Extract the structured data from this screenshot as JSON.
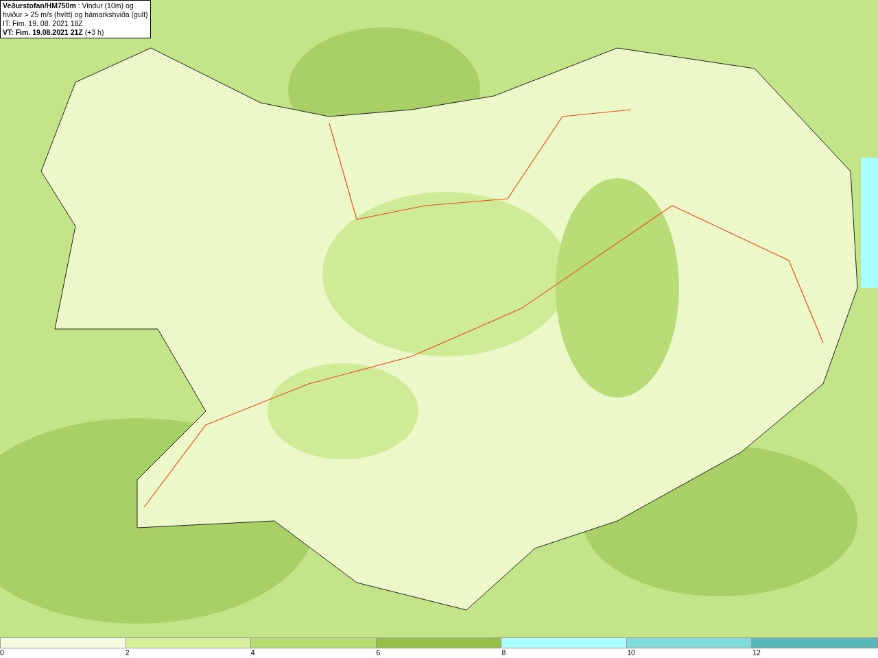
{
  "header": {
    "lines": [
      "**Veðurstofan/HM750m** : Vindur (10m) og",
      "hviður > 25 m/s (hvítt) og hámarkshviða (gult)",
      "IT: Fim. 19. 08. 2021 18Z",
      "**VT: Fim. 19.08.2021 21Z** (+3 h)"
    ]
  },
  "legend": [
    {
      "label": "0",
      "color": "#f7fde0"
    },
    {
      "label": "2",
      "color": "#d8f09a"
    },
    {
      "label": "4",
      "color": "#b8dc70"
    },
    {
      "label": "6",
      "color": "#98c046"
    },
    {
      "label": "8",
      "color": "#aaffff"
    },
    {
      "label": "10",
      "color": "#80dcdc"
    },
    {
      "label": "12",
      "color": "#58b8bc"
    }
  ]
}
